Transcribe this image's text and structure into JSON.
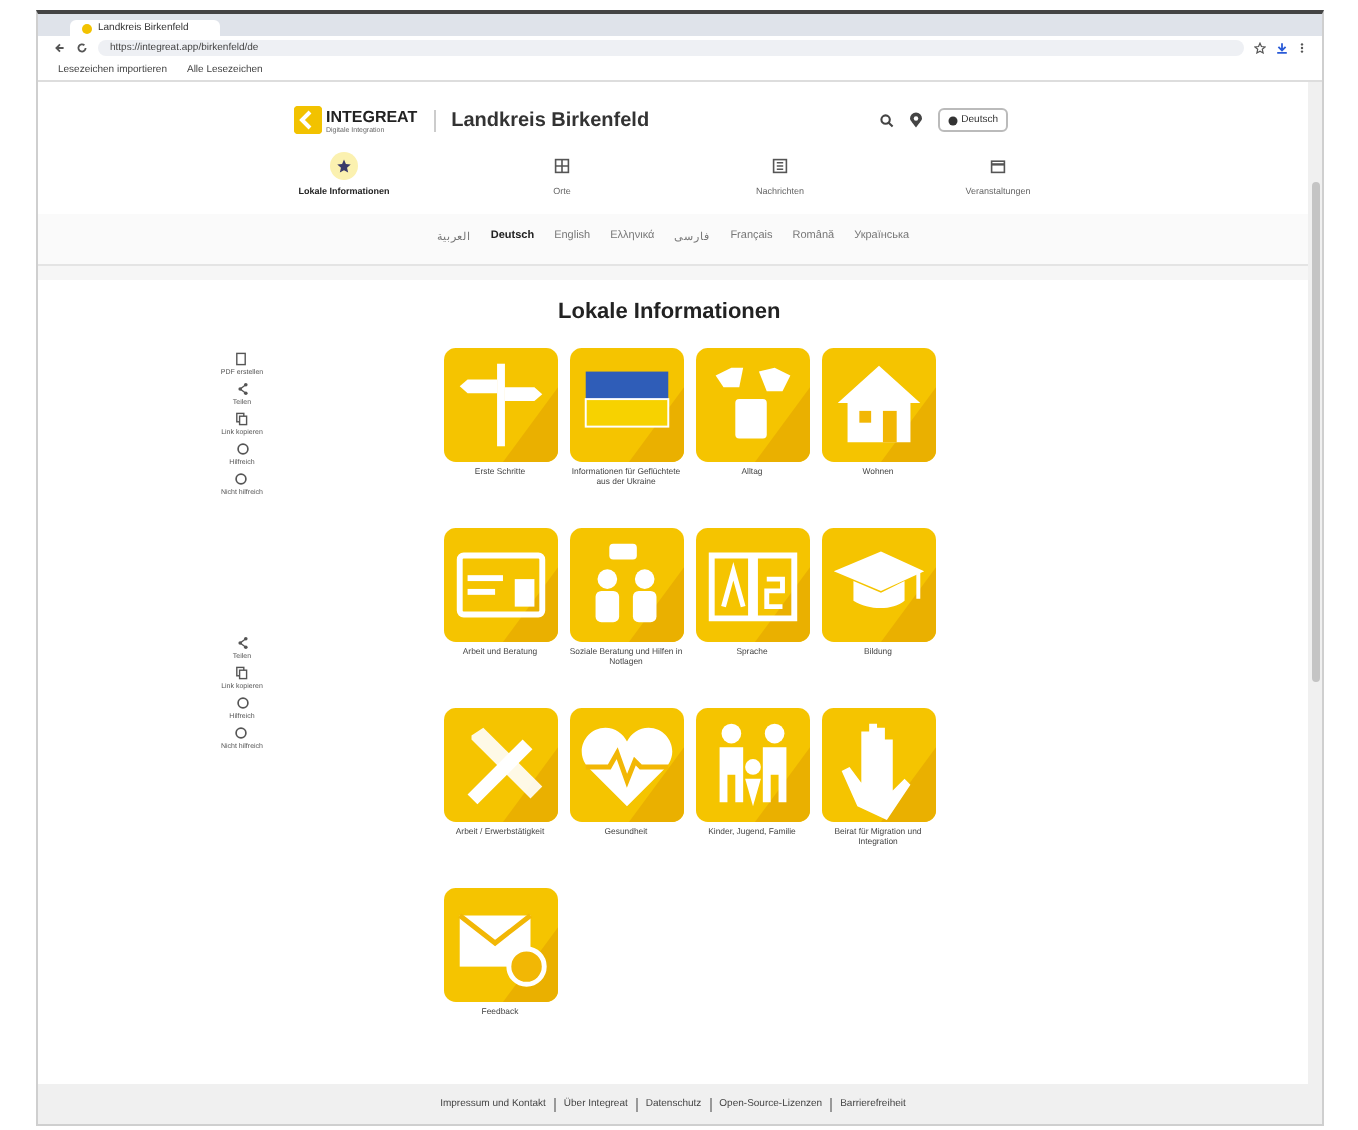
{
  "browser": {
    "tab_title": "Landkreis Birkenfeld",
    "url": "https://integreat.app/birkenfeld/de",
    "bookmarks": [
      "Lesezeichen importieren",
      "Alle Lesezeichen"
    ]
  },
  "header": {
    "logo_text": "INTEGREAT",
    "logo_subtitle": "Digitale Integration",
    "region": "Landkreis Birkenfeld",
    "language_button": "Deutsch"
  },
  "tabs": [
    {
      "label": "Lokale Informationen",
      "selected": true
    },
    {
      "label": "Orte",
      "selected": false
    },
    {
      "label": "Nachrichten",
      "selected": false
    },
    {
      "label": "Veranstaltungen",
      "selected": false
    }
  ],
  "languages": [
    {
      "label": "العربية",
      "selected": false
    },
    {
      "label": "Deutsch",
      "selected": true
    },
    {
      "label": "English",
      "selected": false
    },
    {
      "label": "Ελληνικά",
      "selected": false
    },
    {
      "label": "فارسی",
      "selected": false
    },
    {
      "label": "Français",
      "selected": false
    },
    {
      "label": "Română",
      "selected": false
    },
    {
      "label": "Українська",
      "selected": false
    }
  ],
  "sidebar_top": [
    "PDF erstellen",
    "Teilen",
    "Link kopieren",
    "Hilfreich",
    "Nicht hilfreich"
  ],
  "sidebar_bottom": [
    "Teilen",
    "Link kopieren",
    "Hilfreich",
    "Nicht hilfreich"
  ],
  "page_title": "Lokale Informationen",
  "categories": [
    "Erste Schritte",
    "Informationen für Geflüchtete aus der Ukraine",
    "Alltag",
    "Wohnen",
    "Arbeit und Beratung",
    "Soziale Beratung und Hilfen in Notlagen",
    "Sprache",
    "Bildung",
    "Arbeit / Erwerbstätigkeit",
    "Gesundheit",
    "Kinder, Jugend, Familie",
    "Beirat für Migration und Integration",
    "Feedback"
  ],
  "footer": [
    "Impressum und Kontakt",
    "Über Integreat",
    "Datenschutz",
    "Open-Source-Lizenzen",
    "Barrierefreiheit"
  ]
}
